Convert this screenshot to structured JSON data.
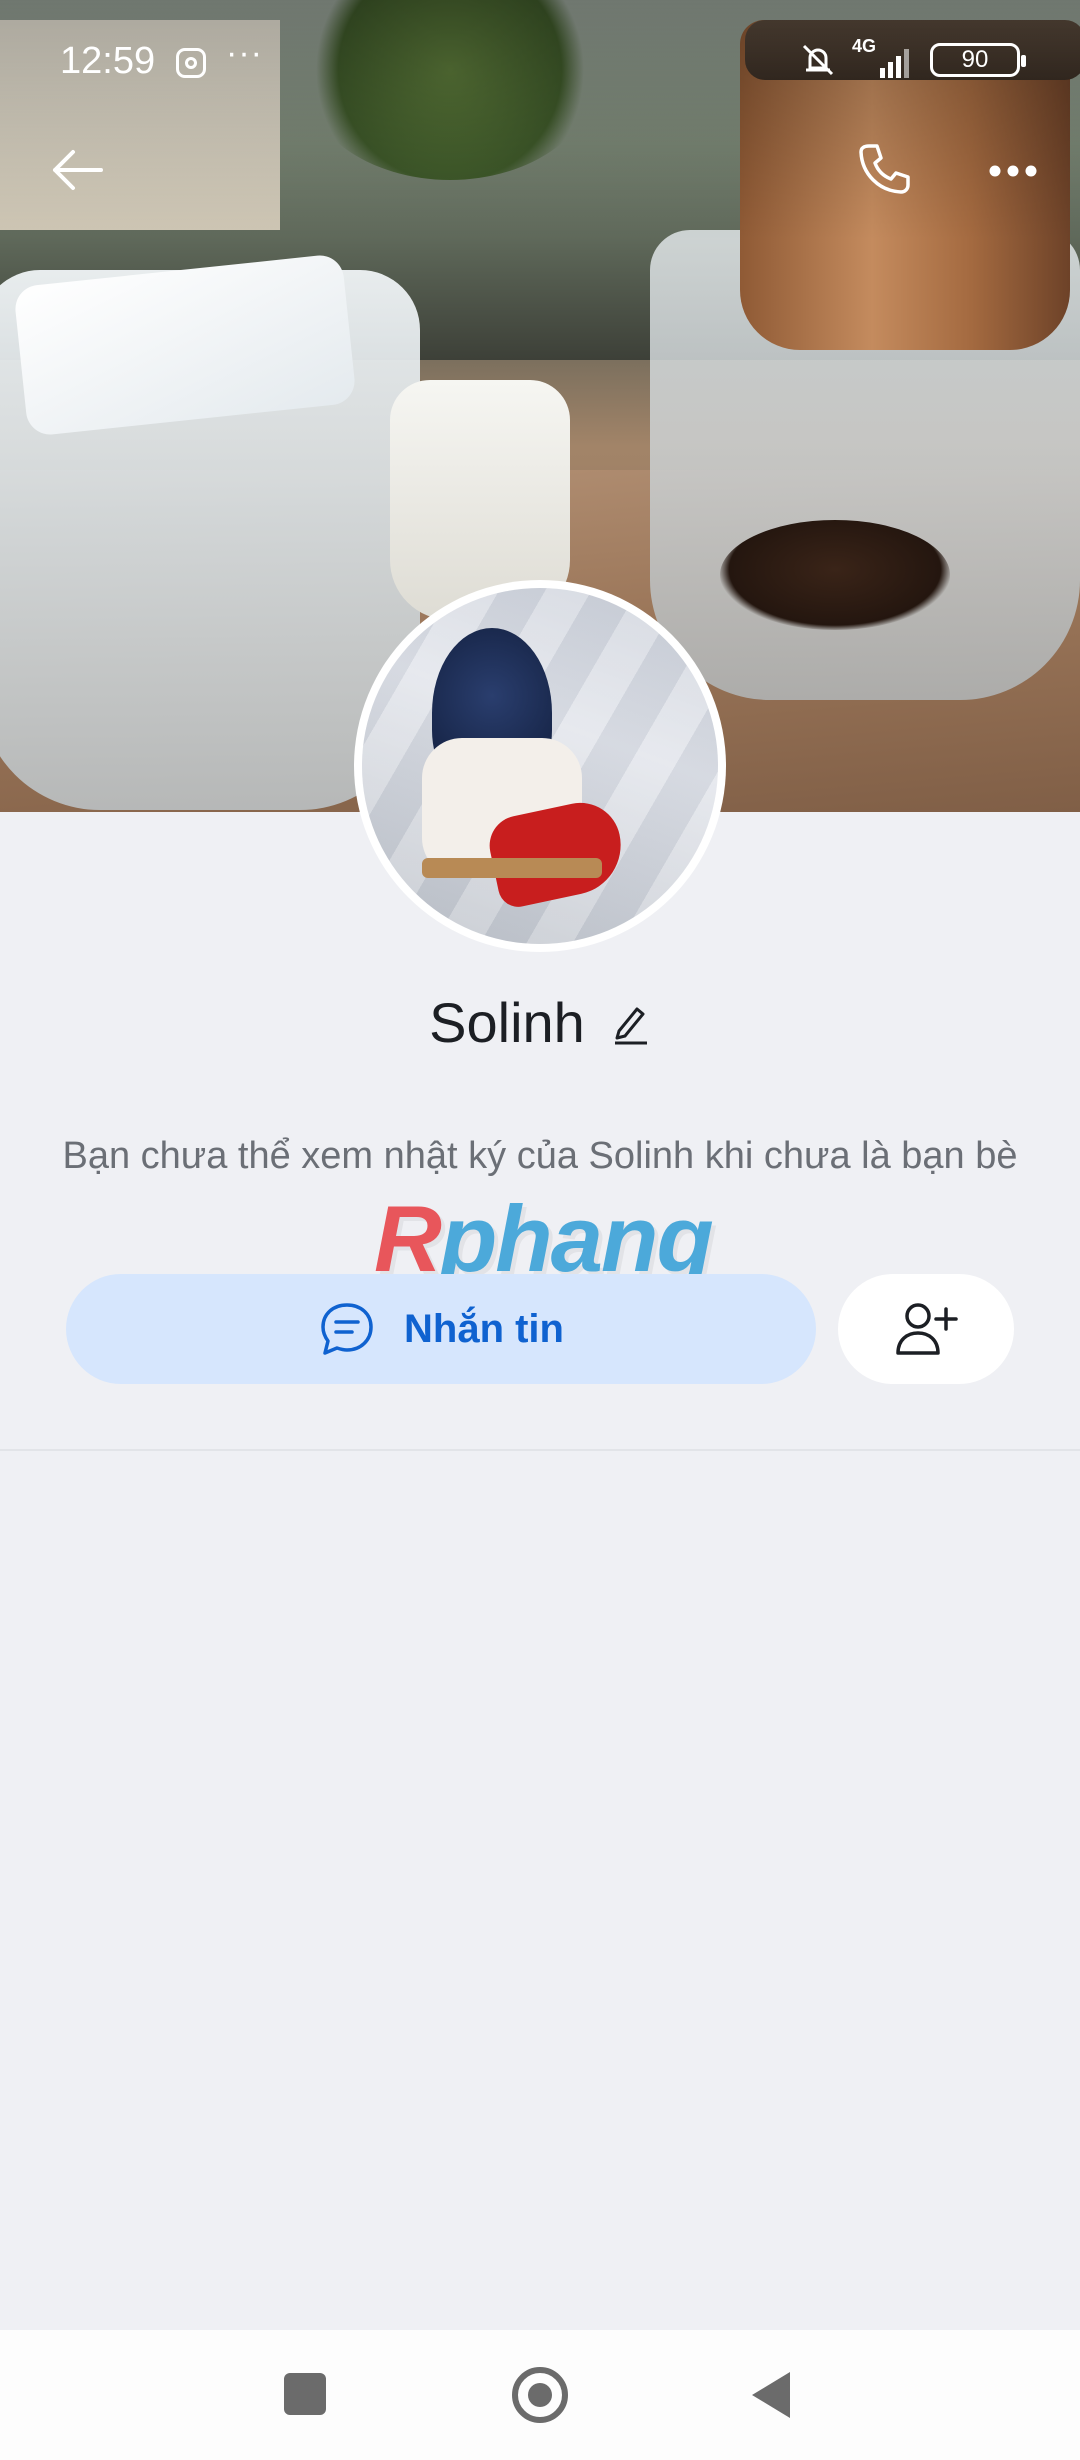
{
  "status_bar": {
    "time": "12:59",
    "more": "···",
    "network": "4G",
    "battery": "90"
  },
  "profile": {
    "name": "Solinh",
    "info": "Bạn chưa thể xem nhật ký của Solinh khi chưa là bạn bè"
  },
  "watermark": {
    "first_letter": "R",
    "rest": "phang"
  },
  "actions": {
    "message_label": "Nhắn tin"
  },
  "colors": {
    "accent": "#0f62d0",
    "message_button_bg": "#d6e6fd",
    "page_bg": "#eff0f4"
  },
  "icons": {
    "back": "back-arrow-icon",
    "call": "phone-icon",
    "more": "more-dots-icon",
    "edit": "pencil-icon",
    "message": "chat-bubble-icon",
    "add_friend": "add-friend-icon"
  }
}
